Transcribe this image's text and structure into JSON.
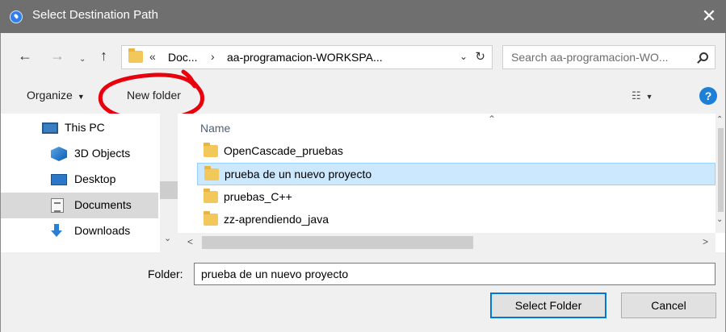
{
  "window": {
    "title": "Select Destination Path",
    "close_glyph": "✕"
  },
  "nav": {
    "back_glyph": "←",
    "forward_glyph": "→",
    "recent_glyph": "⌄",
    "up_glyph": "↑",
    "breadcrumb_overflow": "«",
    "breadcrumb_1": "Doc...",
    "breadcrumb_sep": "›",
    "breadcrumb_2": "aa-programacion-WORKSPA...",
    "address_dropdown": "⌄",
    "refresh_glyph": "↻",
    "search_placeholder": "Search aa-programacion-WO..."
  },
  "toolbar": {
    "organize_label": "Organize",
    "organize_caret": "▼",
    "new_folder_label": "New folder",
    "view_glyph": "☷",
    "view_caret": "▼",
    "help_label": "?"
  },
  "sidebar": {
    "items": [
      {
        "label": "This PC",
        "icon": "this-pc-icon"
      },
      {
        "label": "3D Objects",
        "icon": "3d-objects-icon"
      },
      {
        "label": "Desktop",
        "icon": "desktop-icon"
      },
      {
        "label": "Documents",
        "icon": "documents-icon",
        "selected": true
      },
      {
        "label": "Downloads",
        "icon": "downloads-icon"
      }
    ],
    "scroll_down_glyph": "⌄"
  },
  "filelist": {
    "column_name": "Name",
    "sort_glyph": "⌃",
    "rows": [
      {
        "name": "OpenCascade_pruebas"
      },
      {
        "name": "prueba de un nuevo proyecto",
        "selected": true
      },
      {
        "name": "pruebas_C++"
      },
      {
        "name": "zz-aprendiendo_java"
      }
    ],
    "scroll_up_glyph": "⌃",
    "scroll_down_glyph": "⌄",
    "scroll_left_glyph": "<",
    "scroll_right_glyph": ">"
  },
  "bottom": {
    "folder_label": "Folder:",
    "folder_value": "prueba de un nuevo proyecto",
    "select_button": "Select Folder",
    "cancel_button": "Cancel"
  },
  "colors": {
    "titlebar": "#6f6f6f",
    "selection": "#cce8ff",
    "accent": "#0078d7",
    "annotation": "#e8000d"
  }
}
